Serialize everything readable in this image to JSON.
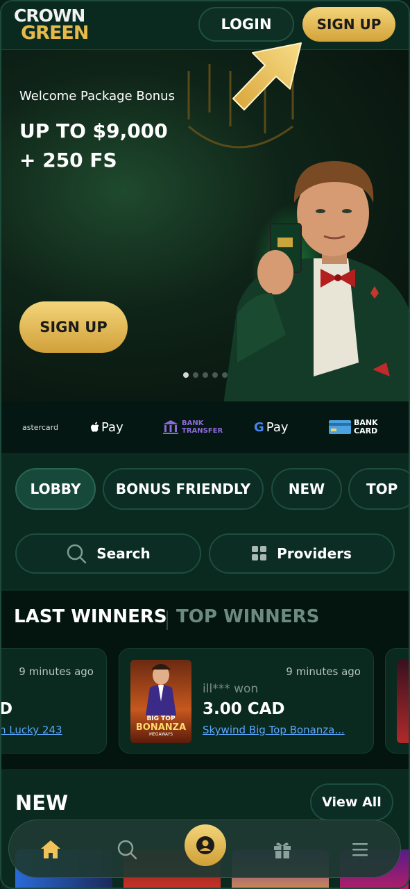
{
  "header": {
    "logo_top": "CROWN",
    "logo_bottom": "GREEN",
    "login_label": "LOGIN",
    "signup_label": "SIGN UP"
  },
  "hero": {
    "bonus_title": "Welcome Package Bonus",
    "amount_line1": "UP TO $9,000",
    "amount_line2": "+ 250 FS",
    "signup_label": "SIGN UP",
    "carousel": {
      "slides": 5,
      "active": 1
    }
  },
  "payments": [
    {
      "name": "mastercard",
      "label": "astercard"
    },
    {
      "name": "apple-pay",
      "label": "Pay"
    },
    {
      "name": "bank-transfer",
      "label_line1": "BANK",
      "label_line2": "TRANSFER"
    },
    {
      "name": "google-pay",
      "label": "Pay"
    },
    {
      "name": "bank-card",
      "label_line1": "BANK",
      "label_line2": "CARD"
    }
  ],
  "categories": {
    "chips": [
      "LOBBY",
      "BONUS FRIENDLY",
      "NEW",
      "TOP"
    ],
    "active": "LOBBY",
    "search_label": "Search",
    "providers_label": "Providers"
  },
  "winners": {
    "tab_last": "LAST WINNERS",
    "tab_top": "TOP WINNERS",
    "cards": [
      {
        "time": "9 minutes ago",
        "amount": "D",
        "game": "n Lucky 243"
      },
      {
        "time": "9 minutes ago",
        "user": "ill*** won",
        "amount": "3.00 CAD",
        "game": "Skywind Big Top Bonanza...",
        "thumb_line1": "BIG TOP",
        "thumb_line2": "BONANZA",
        "thumb_line3": "MEGAWAYS"
      }
    ]
  },
  "new_section": {
    "title": "NEW",
    "view_all_label": "View All"
  },
  "bottom_nav": [
    "home-icon",
    "search-icon",
    "account-icon",
    "gift-icon",
    "menu-icon"
  ],
  "colors": {
    "background": "#071f18",
    "panel": "#0a2a20",
    "gold": "#e6b94a",
    "link": "#5aa6ff"
  }
}
